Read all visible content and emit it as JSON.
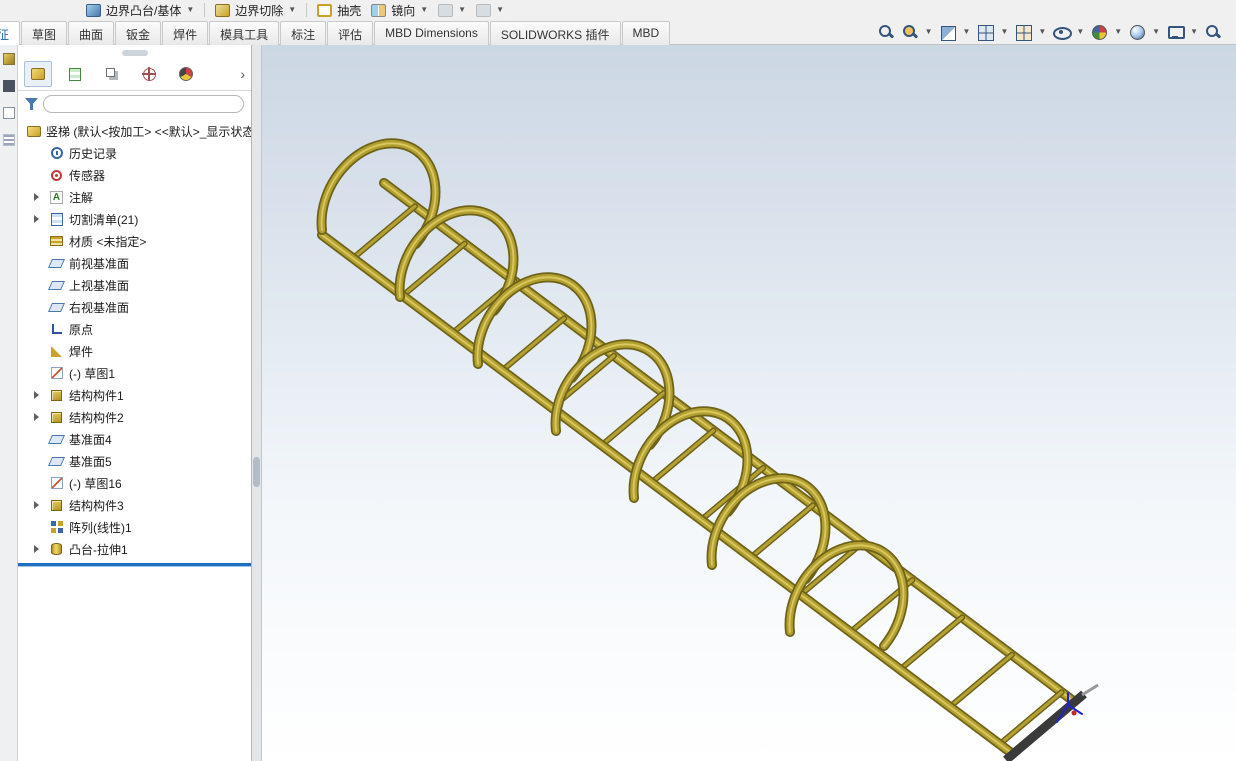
{
  "ribbon": {
    "tool_buttons": [
      {
        "id": "boundary-boss",
        "label": "边界凸台/基体",
        "caret": true,
        "divider_after": true
      },
      {
        "id": "boundary-cut",
        "label": "边界切除",
        "caret": true,
        "divider_after": true
      },
      {
        "id": "shell",
        "label": "抽壳",
        "caret": false,
        "divider_after": false
      },
      {
        "id": "mirror",
        "label": "镜向",
        "caret": true,
        "divider_after": false
      },
      {
        "id": "stub1",
        "label": "",
        "caret": true,
        "divider_after": false
      },
      {
        "id": "stub2",
        "label": "",
        "caret": true,
        "divider_after": false
      }
    ],
    "tabs": [
      "特征",
      "草图",
      "曲面",
      "钣金",
      "焊件",
      "模具工具",
      "标注",
      "评估",
      "MBD Dimensions",
      "SOLIDWORKS 插件",
      "MBD"
    ],
    "active_tab": "特征",
    "view_tools": [
      {
        "name": "zoom-to-fit",
        "caret": false
      },
      {
        "name": "zoom-to-area",
        "caret": true
      },
      {
        "name": "section-view",
        "caret": true
      },
      {
        "name": "view-orientation",
        "caret": true
      },
      {
        "name": "display-style",
        "caret": true
      },
      {
        "name": "hide-show-items",
        "caret": true
      },
      {
        "name": "edit-appearance",
        "caret": true
      },
      {
        "name": "apply-scene",
        "caret": true
      },
      {
        "name": "view-settings",
        "caret": true
      },
      {
        "name": "magnifier",
        "caret": false
      }
    ]
  },
  "edge_strip": {
    "icons": [
      "edge-ic1",
      "edge-ic2",
      "edge-ic3",
      "edge-ic4"
    ]
  },
  "panel": {
    "tabs": [
      {
        "name": "featuremanager",
        "active": true
      },
      {
        "name": "propertymanager",
        "active": false
      },
      {
        "name": "configurationmanager",
        "active": false
      },
      {
        "name": "dimxpertmanager",
        "active": false
      },
      {
        "name": "displaymanager",
        "active": false
      }
    ],
    "expand_chevron": "›",
    "filter_value": "",
    "tree": {
      "root": {
        "label": "竖梯 (默认<按加工> <<默认>_显示状态",
        "icon": "part"
      },
      "items": [
        {
          "name": "history",
          "label": "历史记录",
          "icon": "history",
          "arrow": false
        },
        {
          "name": "sensors",
          "label": "传感器",
          "icon": "sensors",
          "arrow": false
        },
        {
          "name": "annotations",
          "label": "注解",
          "icon": "annotations",
          "arrow": true
        },
        {
          "name": "cut-list",
          "label": "切割清单(21)",
          "icon": "cutlist",
          "arrow": true
        },
        {
          "name": "material",
          "label": "材质 <未指定>",
          "icon": "material",
          "arrow": false
        },
        {
          "name": "front-plane",
          "label": "前视基准面",
          "icon": "plane",
          "arrow": false
        },
        {
          "name": "top-plane",
          "label": "上视基准面",
          "icon": "plane",
          "arrow": false
        },
        {
          "name": "right-plane",
          "label": "右视基准面",
          "icon": "plane",
          "arrow": false
        },
        {
          "name": "origin",
          "label": "原点",
          "icon": "origin",
          "arrow": false
        },
        {
          "name": "weldment",
          "label": "焊件",
          "icon": "weldment",
          "arrow": false
        },
        {
          "name": "sketch1",
          "label": "(-) 草图1",
          "icon": "sketch",
          "arrow": false
        },
        {
          "name": "structural-member1",
          "label": "结构构件1",
          "icon": "structural",
          "arrow": true
        },
        {
          "name": "structural-member2",
          "label": "结构构件2",
          "icon": "structural",
          "arrow": true
        },
        {
          "name": "plane4",
          "label": "基准面4",
          "icon": "plane",
          "arrow": false
        },
        {
          "name": "plane5",
          "label": "基准面5",
          "icon": "plane",
          "arrow": false
        },
        {
          "name": "sketch16",
          "label": "(-) 草图16",
          "icon": "sketch",
          "arrow": false
        },
        {
          "name": "structural-member3",
          "label": "结构构件3",
          "icon": "structural",
          "arrow": true
        },
        {
          "name": "linear-pattern1",
          "label": "阵列(线性)1",
          "icon": "pattern",
          "arrow": false
        },
        {
          "name": "boss-extrude1",
          "label": "凸台-拉伸1",
          "icon": "extrude",
          "arrow": true
        }
      ]
    }
  },
  "model": {
    "description": "gold welded ladder with 7 safety cage hoops, isometric view",
    "colors": {
      "gold_mid": "#b2a033",
      "gold_light": "#dbc95e",
      "gold_dark": "#6e6118",
      "end_cap": "#3a3a3a",
      "origin_blue": "#2222cc",
      "origin_red": "#cc2222"
    }
  }
}
